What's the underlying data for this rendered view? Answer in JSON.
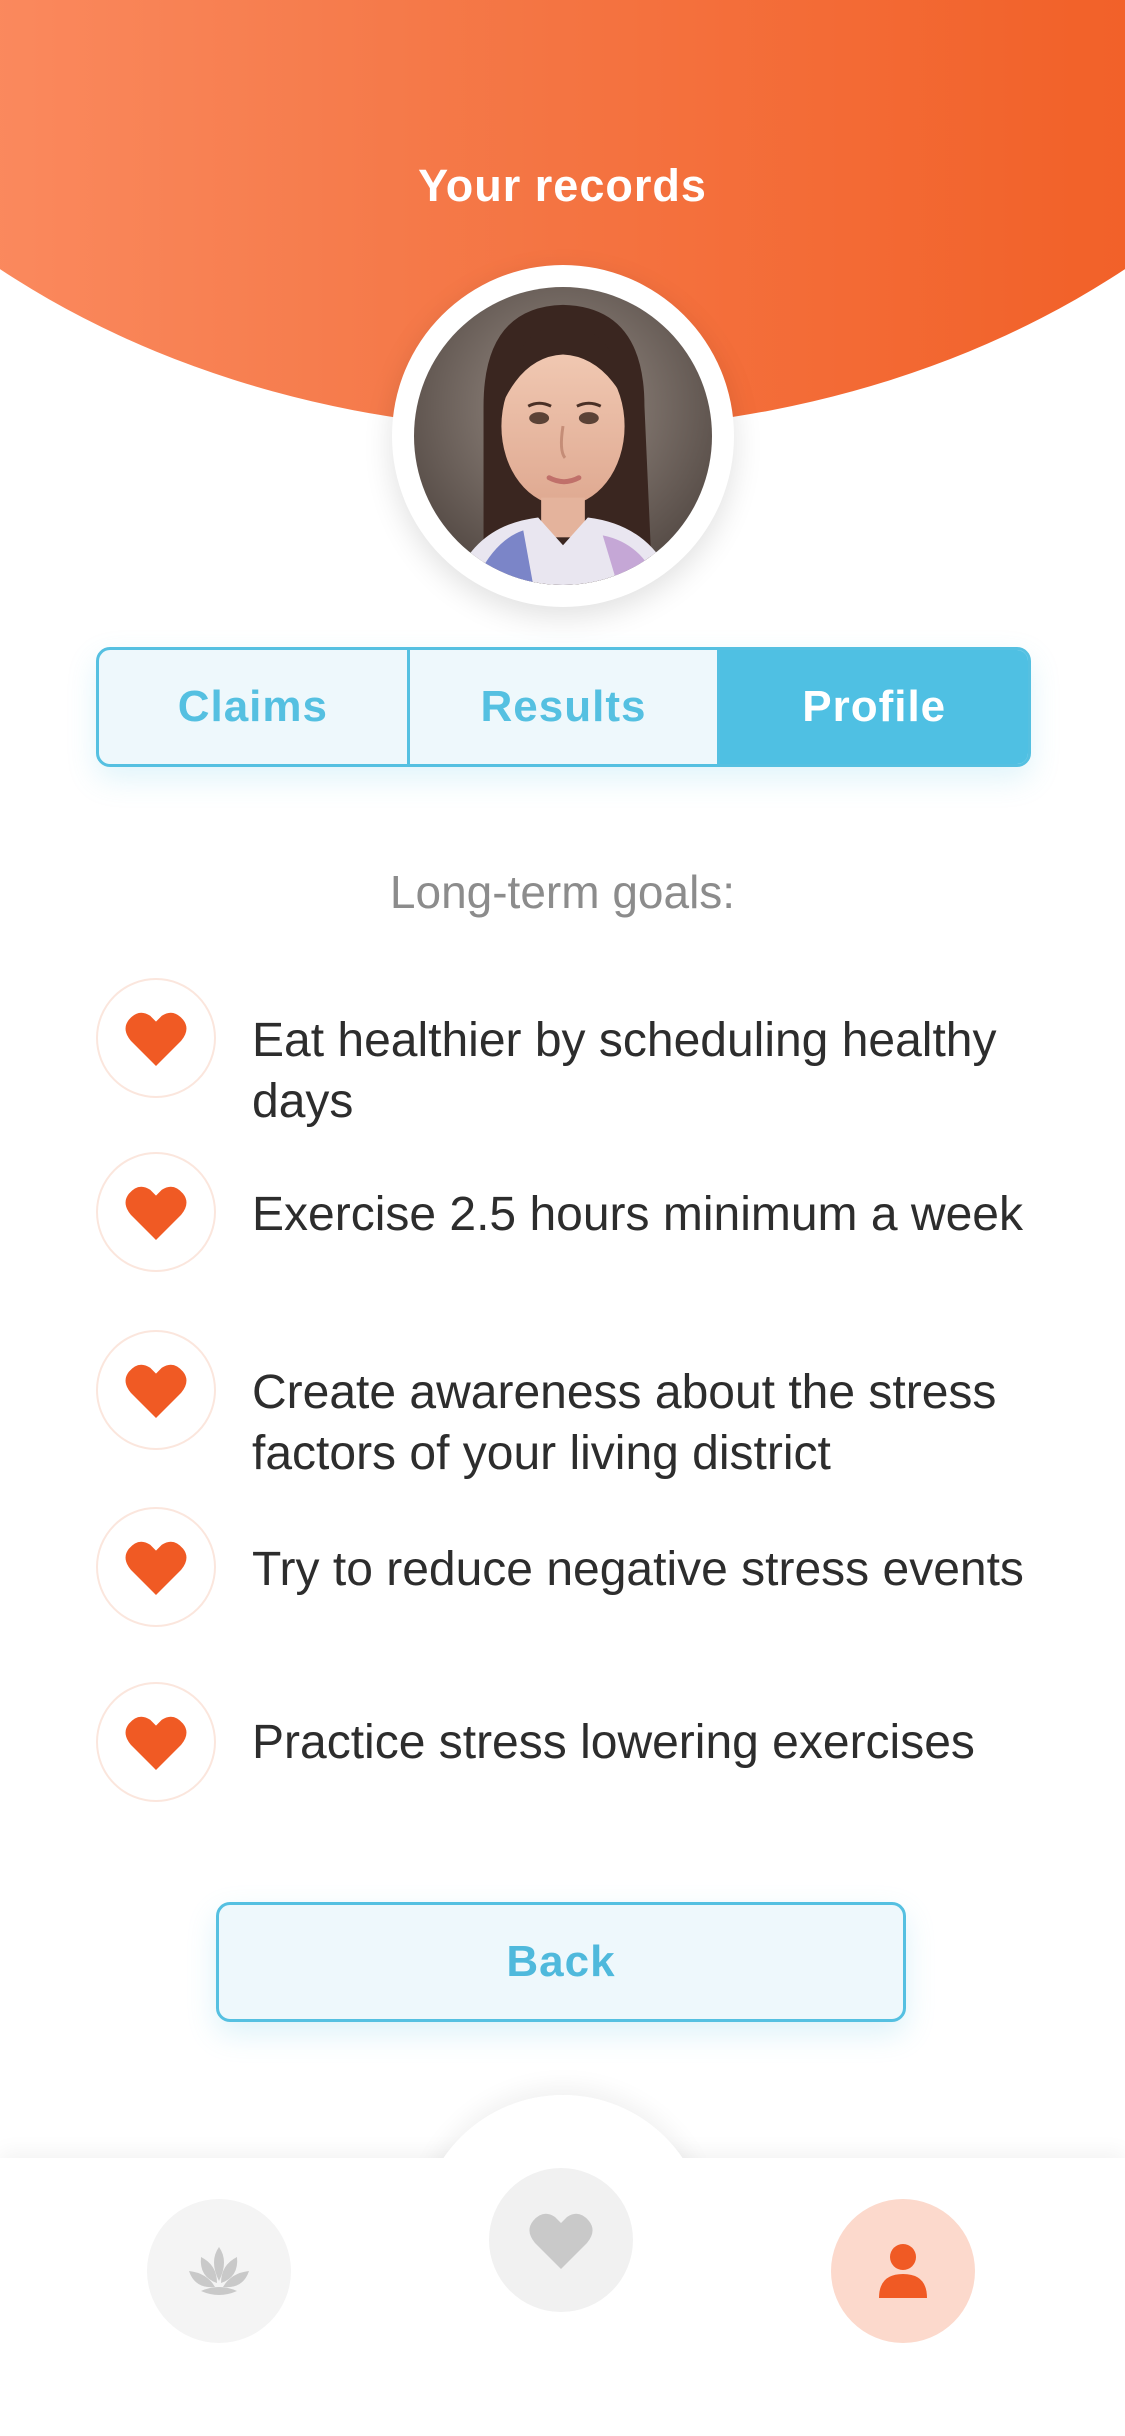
{
  "header": {
    "title": "Your records"
  },
  "tabs": [
    {
      "label": "Claims",
      "active": false
    },
    {
      "label": "Results",
      "active": false
    },
    {
      "label": "Profile",
      "active": true
    }
  ],
  "goals_section": {
    "title": "Long-term goals:",
    "items": [
      {
        "text": "Eat healthier by scheduling healthy days",
        "icon": "heart-icon"
      },
      {
        "text": "Exercise 2.5 hours minimum a week",
        "icon": "heart-icon"
      },
      {
        "text": "Create awareness about the stress factors of your living district",
        "icon": "heart-icon"
      },
      {
        "text": "Try to reduce negative stress events",
        "icon": "heart-icon"
      },
      {
        "text": "Practice stress lowering exercises",
        "icon": "heart-icon"
      }
    ]
  },
  "back_button": {
    "label": "Back"
  },
  "bottom_nav": {
    "items": [
      {
        "icon": "lotus-icon",
        "active": false
      },
      {
        "icon": "heart-icon",
        "active": false
      },
      {
        "icon": "user-icon",
        "active": true
      }
    ]
  },
  "colors": {
    "accent_orange": "#f05a24",
    "accent_blue": "#4fc0e3",
    "text_dark": "#2d2d2d",
    "text_muted": "#8c8c8c"
  }
}
